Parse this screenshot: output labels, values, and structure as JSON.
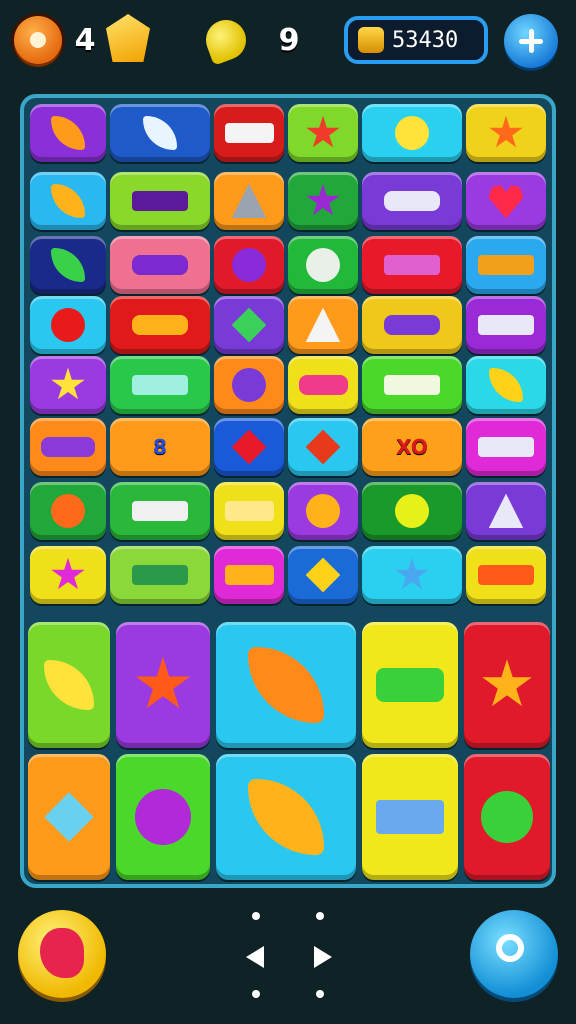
{
  "hud": {
    "gear_count": "4",
    "lemon_count": "9",
    "coins": "53430"
  },
  "colors": {
    "background": "#0f2226",
    "board": "#13475e",
    "board_border": "#3aa6c8"
  },
  "tiles": [
    {
      "col": 0,
      "row": 0,
      "color": "#8b2fd8",
      "icon": "leaf-icon",
      "shape": "leaf",
      "fg": "#ff9a1a"
    },
    {
      "col": 1,
      "row": 0,
      "color": "#1e5ac8",
      "icon": "fish-icon",
      "shape": "leaf",
      "fg": "#e8f4ff"
    },
    {
      "col": 2,
      "row": 0,
      "color": "#d81c1c",
      "icon": "flag-icon",
      "shape": "rect",
      "fg": "#f4f4f4"
    },
    {
      "col": 3,
      "row": 0,
      "color": "#7fd82a",
      "icon": "virus-icon",
      "shape": "star",
      "fg": "#f03a2a"
    },
    {
      "col": 4,
      "row": 0,
      "color": "#2ad0f0",
      "icon": "smiley-blob-icon",
      "shape": "circle",
      "fg": "#ffe23a"
    },
    {
      "col": 5,
      "row": 0,
      "color": "#f0d21a",
      "icon": "sun-face-icon",
      "shape": "star",
      "fg": "#ff6a1a"
    },
    {
      "col": 0,
      "row": 1,
      "color": "#2ab8f0",
      "icon": "fish-icon",
      "shape": "leaf",
      "fg": "#ffb21a"
    },
    {
      "col": 1,
      "row": 1,
      "color": "#8ad82a",
      "icon": "scroll-icon",
      "shape": "rect",
      "fg": "#5a1a9a"
    },
    {
      "col": 2,
      "row": 1,
      "color": "#ff9a1a",
      "icon": "wrench-icon",
      "shape": "tri",
      "fg": "#9aa4b0"
    },
    {
      "col": 3,
      "row": 1,
      "color": "#22a83a",
      "icon": "grapes-icon",
      "shape": "star",
      "fg": "#9a2ad0"
    },
    {
      "col": 4,
      "row": 1,
      "color": "#7a3ad8",
      "icon": "bead-bar-icon",
      "shape": "pill",
      "fg": "#e8e8f8"
    },
    {
      "col": 5,
      "row": 1,
      "color": "#9a3ae0",
      "icon": "heart-icon",
      "shape": "heart",
      "fg": "#ff2a4a"
    },
    {
      "col": 0,
      "row": 2,
      "color": "#1a2a8a",
      "icon": "leaf-icon",
      "shape": "leaf",
      "fg": "#3ad04a"
    },
    {
      "col": 1,
      "row": 2,
      "color": "#f07090",
      "icon": "grapes-icon",
      "shape": "pill",
      "fg": "#7a2ad0"
    },
    {
      "col": 2,
      "row": 2,
      "color": "#e01a2a",
      "icon": "grapes-icon",
      "shape": "circle",
      "fg": "#8a2ad8"
    },
    {
      "col": 3,
      "row": 2,
      "color": "#22b83a",
      "icon": "key-icon",
      "shape": "circle",
      "fg": "#e8f0e8"
    },
    {
      "col": 4,
      "row": 2,
      "color": "#e81a2a",
      "icon": "gift-icon",
      "shape": "rect",
      "fg": "#e060d0"
    },
    {
      "col": 5,
      "row": 2,
      "color": "#2aa8f0",
      "icon": "photo-icon",
      "shape": "rect",
      "fg": "#f0a01a"
    },
    {
      "col": 0,
      "row": 3,
      "color": "#2ac8f0",
      "icon": "apple-icon",
      "shape": "circle",
      "fg": "#e81a1a"
    },
    {
      "col": 1,
      "row": 3,
      "color": "#e01a1a",
      "icon": "bottle-icon",
      "shape": "pill",
      "fg": "#ffb21a"
    },
    {
      "col": 2,
      "row": 3,
      "color": "#7a3ad8",
      "icon": "envelope-icon",
      "shape": "diamond",
      "fg": "#3ad05a"
    },
    {
      "col": 3,
      "row": 3,
      "color": "#ff9a1a",
      "icon": "cone-icon",
      "shape": "tri",
      "fg": "#f4f4f4"
    },
    {
      "col": 4,
      "row": 3,
      "color": "#f0c81a",
      "icon": "bead-bar-icon",
      "shape": "pill",
      "fg": "#7a3ad8"
    },
    {
      "col": 5,
      "row": 3,
      "color": "#9a2ad8",
      "icon": "list-icon",
      "shape": "rect",
      "fg": "#e8e8f8"
    },
    {
      "col": 0,
      "row": 4,
      "color": "#9a3ae0",
      "icon": "sun-face-icon",
      "shape": "star",
      "fg": "#ffe23a"
    },
    {
      "col": 1,
      "row": 4,
      "color": "#2ac84a",
      "icon": "sign-icon",
      "shape": "rect",
      "fg": "#a0f0e0"
    },
    {
      "col": 2,
      "row": 4,
      "color": "#ff8a1a",
      "icon": "donut-icon",
      "shape": "circle",
      "fg": "#7a3ad8"
    },
    {
      "col": 3,
      "row": 4,
      "color": "#f0e01a",
      "icon": "purse-icon",
      "shape": "pill",
      "fg": "#f03a8a"
    },
    {
      "col": 4,
      "row": 4,
      "color": "#4ad82a",
      "icon": "domino-icon",
      "shape": "rect",
      "fg": "#f0f8e0"
    },
    {
      "col": 5,
      "row": 4,
      "color": "#2ad8e8",
      "icon": "carrot-icon",
      "shape": "leaf",
      "fg": "#ffd21a"
    },
    {
      "col": 0,
      "row": 5,
      "color": "#ff8a1a",
      "icon": "bead-bar-icon",
      "shape": "pill",
      "fg": "#8a3ad8"
    },
    {
      "col": 1,
      "row": 5,
      "color": "#ff9a1a",
      "icon": "number-icon",
      "shape": "rect",
      "fg": "#2a4ad8",
      "text": "8"
    },
    {
      "col": 2,
      "row": 5,
      "color": "#1a5ad8",
      "icon": "envelope-icon",
      "shape": "diamond",
      "fg": "#e81a2a"
    },
    {
      "col": 3,
      "row": 5,
      "color": "#2ac8f0",
      "icon": "drop-icon",
      "shape": "diamond",
      "fg": "#e83a1a"
    },
    {
      "col": 4,
      "row": 5,
      "color": "#ffa01a",
      "icon": "xo-icon",
      "shape": "rect",
      "fg": "#d81a1a",
      "text": "XO"
    },
    {
      "col": 5,
      "row": 5,
      "color": "#e02ad8",
      "icon": "wand-icon",
      "shape": "rect",
      "fg": "#e8e8f8"
    },
    {
      "col": 0,
      "row": 6,
      "color": "#22a83a",
      "icon": "apple-icon",
      "shape": "circle",
      "fg": "#ff6a1a"
    },
    {
      "col": 1,
      "row": 6,
      "color": "#2ab83a",
      "icon": "scroll-icon",
      "shape": "rect",
      "fg": "#f0f0f0"
    },
    {
      "col": 2,
      "row": 6,
      "color": "#f0e01a",
      "icon": "robot-face-icon",
      "shape": "rect",
      "fg": "#ffe88a"
    },
    {
      "col": 3,
      "row": 6,
      "color": "#9a3ae0",
      "icon": "lemon-icon",
      "shape": "circle",
      "fg": "#ffb21a"
    },
    {
      "col": 4,
      "row": 6,
      "color": "#1a9a2a",
      "icon": "bulb-icon",
      "shape": "circle",
      "fg": "#e8f01a"
    },
    {
      "col": 5,
      "row": 6,
      "color": "#7a3ad8",
      "icon": "drill-icon",
      "shape": "tri",
      "fg": "#e8e8f8"
    },
    {
      "col": 0,
      "row": 7,
      "color": "#f0e01a",
      "icon": "bird-icon",
      "shape": "star",
      "fg": "#e02ad8"
    },
    {
      "col": 1,
      "row": 7,
      "color": "#8ad83a",
      "icon": "sign-icon",
      "shape": "rect",
      "fg": "#2a9a4a"
    },
    {
      "col": 2,
      "row": 7,
      "color": "#e02ad8",
      "icon": "pencil-icon",
      "shape": "rect",
      "fg": "#ffb21a"
    },
    {
      "col": 3,
      "row": 7,
      "color": "#1a6ad8",
      "icon": "cross-icon",
      "shape": "diamond",
      "fg": "#ffd21a"
    },
    {
      "col": 4,
      "row": 7,
      "color": "#2ad0f0",
      "icon": "star-blob-icon",
      "shape": "star",
      "fg": "#4aa8f0"
    },
    {
      "col": 5,
      "row": 7,
      "color": "#f0e01a",
      "icon": "robot-face-icon",
      "shape": "rect",
      "fg": "#ff5a1a"
    },
    {
      "col": 0,
      "row": 8,
      "colspan": 1,
      "rowspan": 1,
      "big": true,
      "color": "#7ad82a",
      "icon": "question-icon",
      "shape": "leaf",
      "fg": "#ffe23a"
    },
    {
      "col": 1,
      "row": 8,
      "big": true,
      "color": "#9a3ae0",
      "icon": "sun-face-icon",
      "shape": "star",
      "fg": "#ff5a1a"
    },
    {
      "col": 2,
      "row": 8,
      "big": true,
      "color": "#2ac8f0",
      "icon": "leaf-icon",
      "shape": "leaf",
      "fg": "#ff8a1a"
    },
    {
      "col": 3,
      "row": 8,
      "big": true,
      "color": "#f0e81a",
      "icon": "bottle-icon",
      "shape": "pill",
      "fg": "#3ad03a"
    },
    {
      "col": 4,
      "row": 8,
      "big": true,
      "color": "#e01a2a",
      "icon": "sun-face-icon",
      "shape": "star",
      "fg": "#ffb21a"
    },
    {
      "col": 0,
      "row": 9,
      "big": true,
      "color": "#ff9a1a",
      "icon": "gem-icon",
      "shape": "diamond",
      "fg": "#6ad0f0"
    },
    {
      "col": 1,
      "row": 9,
      "big": true,
      "color": "#4ad82a",
      "icon": "bulb-icon",
      "shape": "circle",
      "fg": "#b02ad8"
    },
    {
      "col": 2,
      "row": 9,
      "big": true,
      "color": "#2ac8f0",
      "icon": "fish-icon",
      "shape": "leaf",
      "fg": "#ffb21a"
    },
    {
      "col": 3,
      "row": 9,
      "big": true,
      "color": "#f0e81a",
      "icon": "speech-bubble-icon",
      "shape": "rect",
      "fg": "#6aa8f0"
    },
    {
      "col": 4,
      "row": 9,
      "big": true,
      "color": "#e01a2a",
      "icon": "question-icon",
      "shape": "circle",
      "fg": "#3ad03a"
    }
  ]
}
